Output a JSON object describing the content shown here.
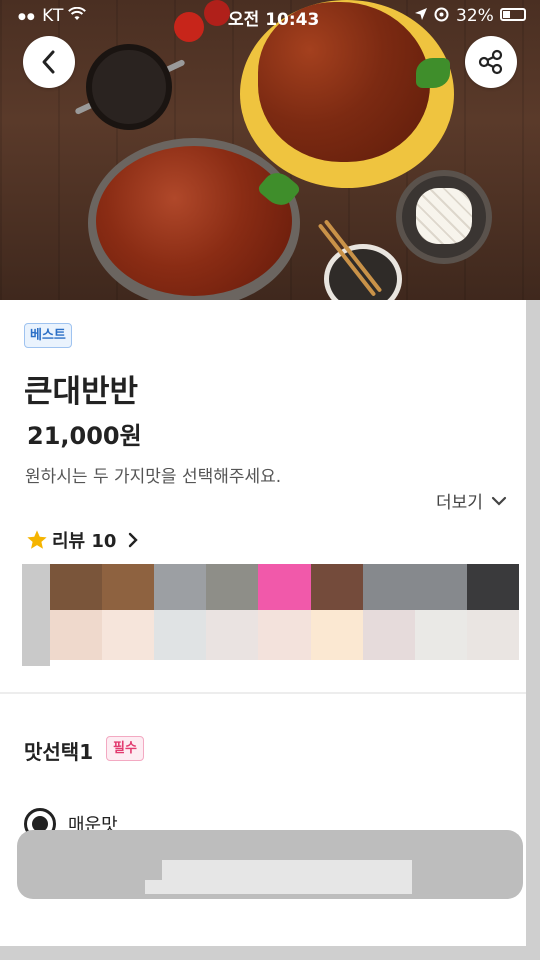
{
  "status_bar": {
    "carrier": "KT",
    "time": "오전 10:43",
    "battery": "32%"
  },
  "product": {
    "badge": "베스트",
    "name": "큰대반반",
    "price": "21,000원",
    "description": "원하시는 두 가지맛을 선택해주세요.",
    "more_label": "더보기",
    "review_label": "리뷰 10"
  },
  "option_section": {
    "title": "맛선택1",
    "required_badge": "필수",
    "options": [
      {
        "label": "매운맛",
        "selected": true
      }
    ]
  },
  "swatch_colors": {
    "top": [
      "#7a553a",
      "#8e6240",
      "#9c9fa3",
      "#8e8e88",
      "#f159aa",
      "#744b3b",
      "#86898d",
      "#86898d",
      "#3a3a3c"
    ],
    "bottom": [
      "#efd9cc",
      "#f6e5db",
      "#e0e3e4",
      "#eae3e1",
      "#f3e2dc",
      "#fbe8d2",
      "#e6dbdb",
      "#eae9e6",
      "#eae5e2"
    ]
  },
  "colors": {
    "best_badge": "#2b6fc6",
    "required_badge": "#e23a6f",
    "star": "#f5b400"
  },
  "icons": [
    "back-icon",
    "share-icon",
    "star-icon",
    "chevron-right-icon",
    "chevron-down-icon",
    "radio-selected-icon"
  ]
}
